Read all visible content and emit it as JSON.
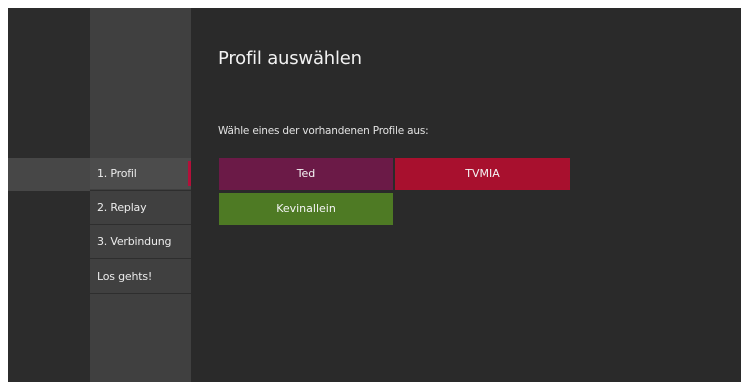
{
  "page": {
    "title": "Profil auswählen",
    "subtitle": "Wähle eines der vorhandenen Profile aus:"
  },
  "steps": [
    {
      "label": "1. Profil",
      "active": true
    },
    {
      "label": "2. Replay",
      "active": false
    },
    {
      "label": "3. Verbindung",
      "active": false
    },
    {
      "label": "Los gehts!",
      "active": false
    }
  ],
  "profiles": [
    {
      "name": "Ted",
      "color": "#6b1a47"
    },
    {
      "name": "TVMIA",
      "color": "#a8102e"
    },
    {
      "name": "Kevinallein",
      "color": "#4e7a24"
    }
  ],
  "colors": {
    "background": "#2a2a2a",
    "steps_column": "#404040",
    "active_marker": "#b3103a"
  }
}
